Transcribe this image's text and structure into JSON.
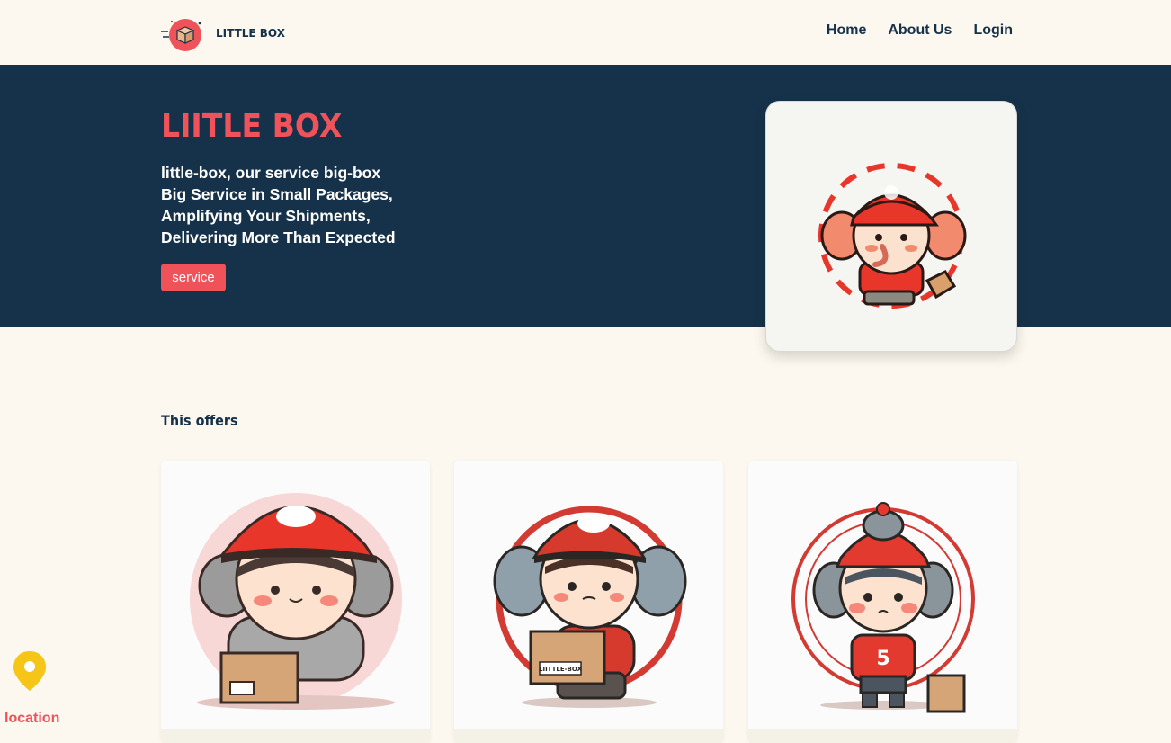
{
  "nav": {
    "brand": "LITTLE BOX",
    "links": [
      "Home",
      "About Us",
      "Login"
    ]
  },
  "hero": {
    "title": "LIITLE BOX",
    "lines": [
      "little-box, our service big-box",
      "Big Service in Small Packages,",
      "Amplifying Your Shipments,",
      "Delivering More Than Expected"
    ],
    "button": "service"
  },
  "offers": {
    "title": "This offers",
    "cards": [
      {
        "icon": "mascot-kneeling-with-box-icon",
        "box_label": ""
      },
      {
        "icon": "mascot-walking-with-box-icon",
        "box_label": "LIITTLE-BOX"
      },
      {
        "icon": "mascot-standing-number-five-icon",
        "shirt_number": "5"
      }
    ]
  },
  "location": {
    "label": "location"
  },
  "colors": {
    "navy": "#16324a",
    "accent": "#f0525a",
    "background": "#fcf8ef",
    "pin": "#f5c518"
  }
}
